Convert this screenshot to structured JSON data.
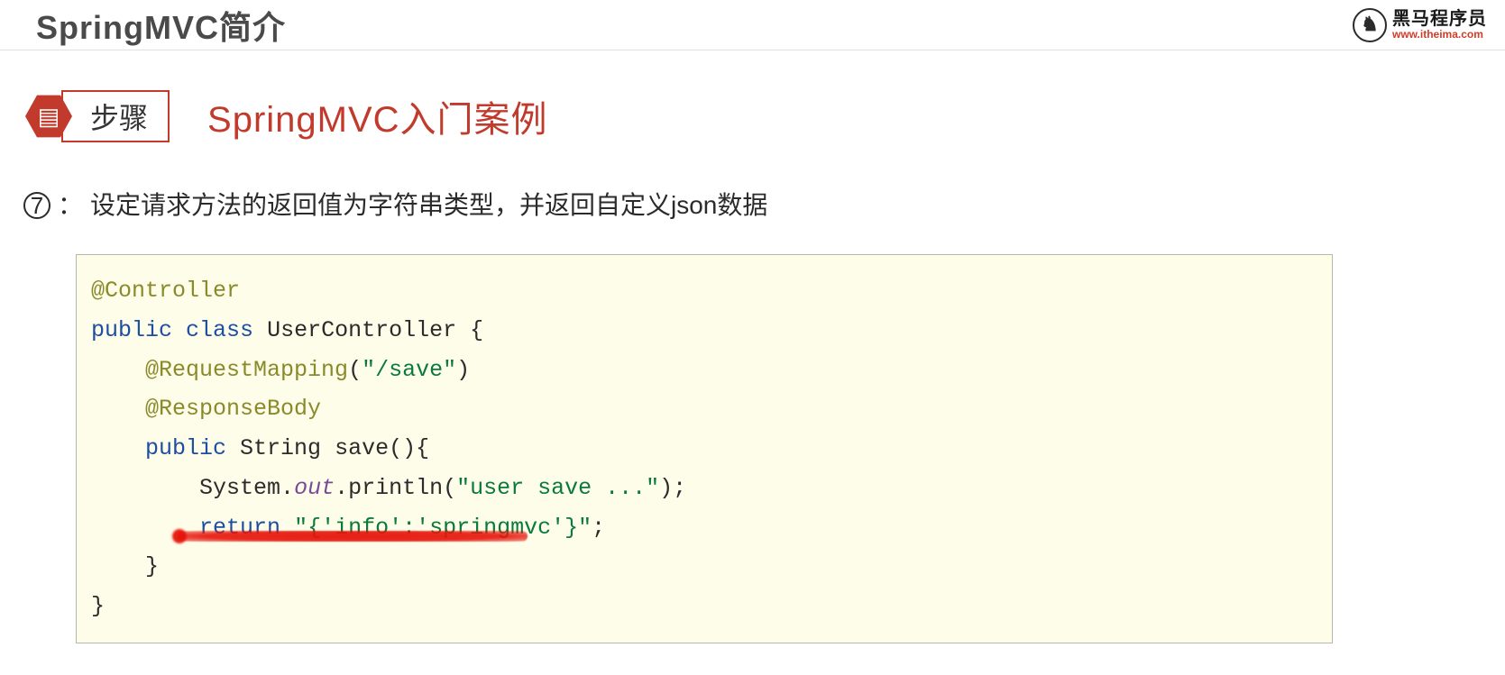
{
  "header": {
    "title": "SpringMVC简介",
    "logo_cn": "黑马程序员",
    "logo_url": "www.itheima.com"
  },
  "step": {
    "label": "步骤",
    "section_title": "SpringMVC入门案例"
  },
  "instruction": {
    "number": "7",
    "text": "设定请求方法的返回值为字符串类型，并返回自定义json数据"
  },
  "code": {
    "anno_controller": "@Controller",
    "kw_public1": "public",
    "kw_class": "class",
    "cls_name": "UserController",
    "brace_open1": "{",
    "anno_reqmap": "@RequestMapping",
    "str_path": "\"/save\"",
    "anno_respbody": "@ResponseBody",
    "kw_public2": "public",
    "type_string": "String",
    "method_save": "save",
    "parens": "()",
    "brace_open2": "{",
    "obj_system": "System.",
    "field_out": "out",
    "method_println": ".println(",
    "str_msg": "\"user save ...\"",
    "close_println": ");",
    "kw_return": "return",
    "str_ret": "\"{'info':'springmvc'}\"",
    "semi": ";",
    "brace_close2": "}",
    "brace_close1": "}"
  }
}
